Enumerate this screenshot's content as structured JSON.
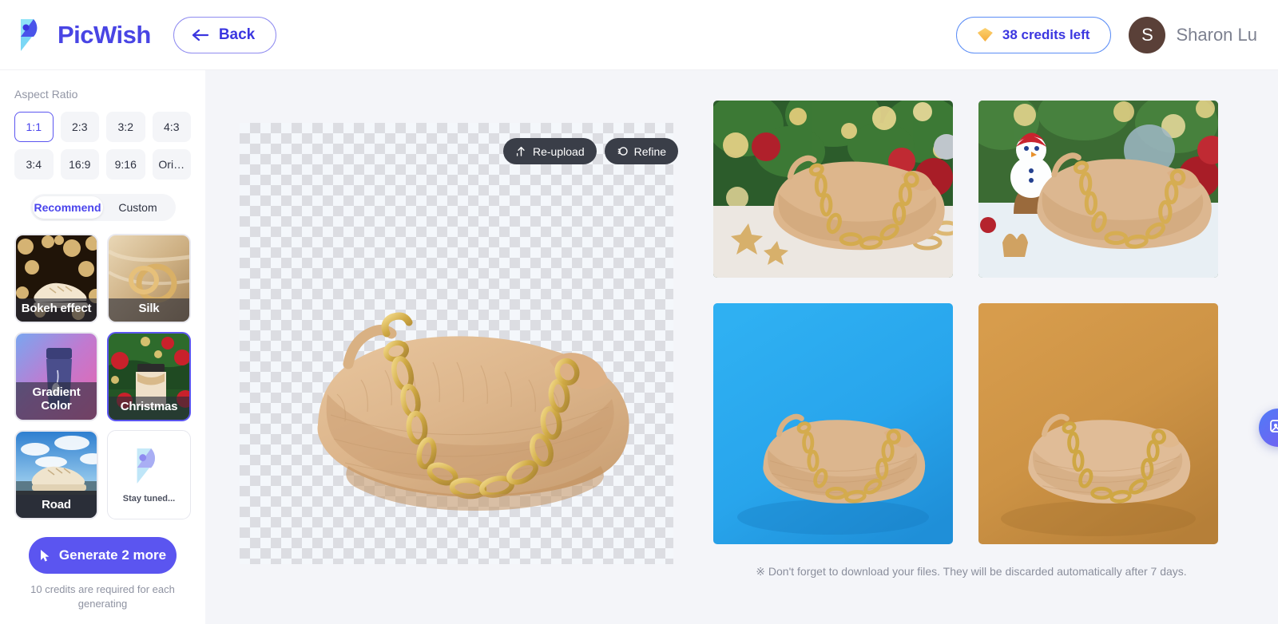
{
  "header": {
    "brand_name": "PicWish",
    "logo_icon": "picwish-logo-icon",
    "back_label": "Back",
    "back_icon": "arrow-left-icon",
    "credits_label": "38 credits left",
    "credits_icon": "diamond-icon",
    "user_initial": "S",
    "user_name": "Sharon Lu"
  },
  "sidebar": {
    "aspect_ratio_label": "Aspect Ratio",
    "ratios": [
      {
        "label": "1:1",
        "active": true
      },
      {
        "label": "2:3",
        "active": false
      },
      {
        "label": "3:2",
        "active": false
      },
      {
        "label": "4:3",
        "active": false
      },
      {
        "label": "3:4",
        "active": false
      },
      {
        "label": "16:9",
        "active": false
      },
      {
        "label": "9:16",
        "active": false
      },
      {
        "label": "Ori…",
        "active": false
      }
    ],
    "segments": [
      {
        "label": "Recommend",
        "active": true
      },
      {
        "label": "Custom",
        "active": false
      }
    ],
    "templates": [
      {
        "label": "Bokeh effect",
        "selected": false,
        "art": "bokeh"
      },
      {
        "label": "Silk",
        "selected": false,
        "art": "silk"
      },
      {
        "label": "Gradient\nColor",
        "selected": false,
        "art": "gradient"
      },
      {
        "label": "Christmas",
        "selected": true,
        "art": "christmas"
      },
      {
        "label": "Road",
        "selected": false,
        "art": "road"
      },
      {
        "label": "Stay tuned...",
        "selected": false,
        "art": "placeholder"
      }
    ],
    "generate_label": "Generate 2 more",
    "generate_icon": "cursor-click-icon",
    "generate_note": "10 credits are required for each generating"
  },
  "canvas": {
    "reupload_label": "Re-upload",
    "reupload_icon": "upload-icon",
    "refine_label": "Refine",
    "refine_icon": "refine-icon",
    "subject_alt": "beige crocodile-pattern shoulder bag with gold chain"
  },
  "results": {
    "items": [
      {
        "name": "result-christmas-tree",
        "background": "#cfd6c3"
      },
      {
        "name": "result-snowman",
        "background": "#cdd8dd"
      },
      {
        "name": "result-blue",
        "background": "#29a8ee"
      },
      {
        "name": "result-orange",
        "background": "#ce9346"
      }
    ],
    "footnote": "※ Don't forget to download your files. They will be discarded automatically after 7 days."
  },
  "fab": {
    "icon": "image-edit-icon"
  },
  "colors": {
    "accent": "#5b55f0",
    "accent_text": "#3b36e0",
    "blue_bg": "#29a8ee",
    "orange_bg": "#ce9346",
    "avatar_bg": "#5a4038",
    "page_bg": "#f4f5f9"
  }
}
